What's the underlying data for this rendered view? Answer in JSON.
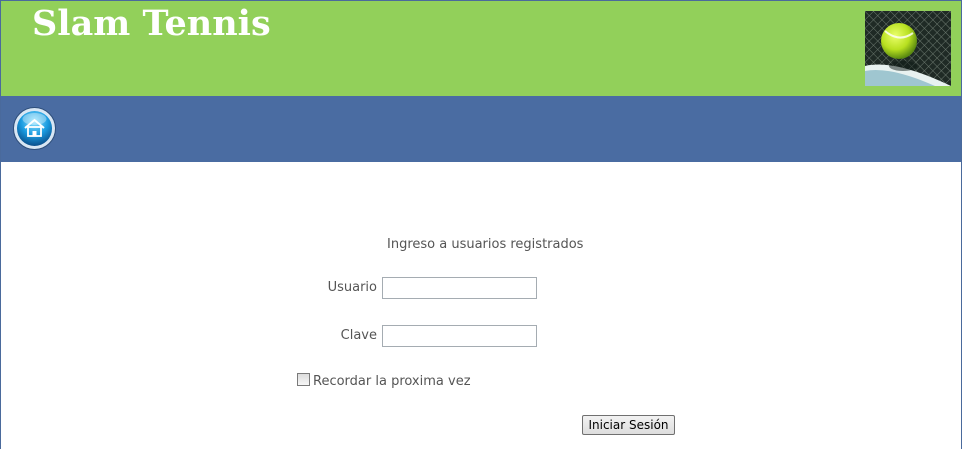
{
  "header": {
    "site_title": "Slam Tennis",
    "background_color": "#92d05a",
    "image_icon": "tennis-ball-on-court-image"
  },
  "navbar": {
    "background_color": "#4a6ca2",
    "home_icon": "home-icon"
  },
  "login": {
    "heading": "Ingreso a usuarios registrados",
    "username_label": "Usuario",
    "username_value": "",
    "password_label": "Clave",
    "password_value": "",
    "remember_label": "Recordar la proxima vez",
    "remember_checked": false,
    "submit_label": "Iniciar Sesión"
  }
}
